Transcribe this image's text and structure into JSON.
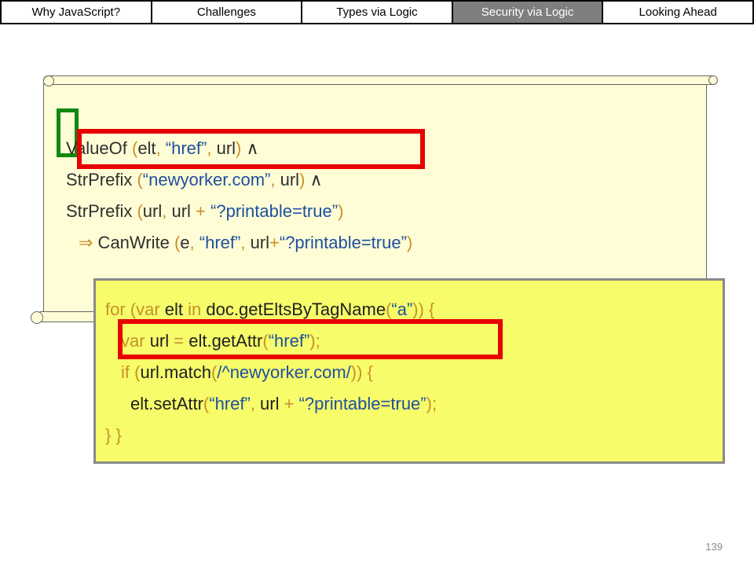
{
  "nav": {
    "tabs": [
      {
        "label": "Why JavaScript?",
        "active": false
      },
      {
        "label": "Challenges",
        "active": false
      },
      {
        "label": "Types via Logic",
        "active": false
      },
      {
        "label": "Security via Logic",
        "active": true
      },
      {
        "label": "Looking Ahead",
        "active": false
      }
    ]
  },
  "formula": {
    "line1": {
      "a": "ValueOf ",
      "b": "(",
      "c": "elt",
      "d": ", ",
      "e": "“href”",
      "f": ", ",
      "g": "url",
      "h": ") ",
      "i": "∧"
    },
    "line2": {
      "a": "StrPrefix ",
      "b": "(",
      "c": "“newyorker.com”",
      "d": ", ",
      "e": "url",
      "f": ") ",
      "g": "∧"
    },
    "line3": {
      "a": "StrPrefix ",
      "b": "(",
      "c": "url",
      "d": ", ",
      "e": "url",
      "f": " + ",
      "g": "“?printable=true”",
      "h": ")"
    },
    "line4": {
      "arrow": "⇒",
      "a": " CanWrite ",
      "b": "(",
      "c": "e",
      "d": ", ",
      "e": "“href”",
      "f": ", ",
      "g": "url",
      "h": "+",
      "i": "“?printable=true”",
      "j": ")"
    }
  },
  "code": {
    "line1": {
      "a": "for (var ",
      "b": "elt",
      "c": " in ",
      "d": "doc.getEltsByTagName",
      "e": "(",
      "f": "“a”",
      "g": ")) {"
    },
    "line2": {
      "a": "var ",
      "b": "url",
      "c": " = ",
      "d": "elt.getAttr",
      "e": "(",
      "f": "“href”",
      "g": ");"
    },
    "line3": {
      "a": "if (",
      "b": "url.match",
      "c": "(",
      "d": "/^newyorker.com/",
      "e": ")) {"
    },
    "line4": {
      "a": "elt.setAttr",
      "b": "(",
      "c": "“href”",
      "d": ", ",
      "e": "url",
      "f": " + ",
      "g": "“?printable=true”",
      "h": ");"
    },
    "line5": {
      "a": "} }"
    }
  },
  "page_number": "139",
  "colors": {
    "accent_highlight": "#e80000",
    "bracket_green": "#0e8a0e",
    "code_box_bg": "#f6fc6a",
    "scroll_bg": "#fffdd6",
    "active_tab_bg": "#7f7f7f"
  }
}
